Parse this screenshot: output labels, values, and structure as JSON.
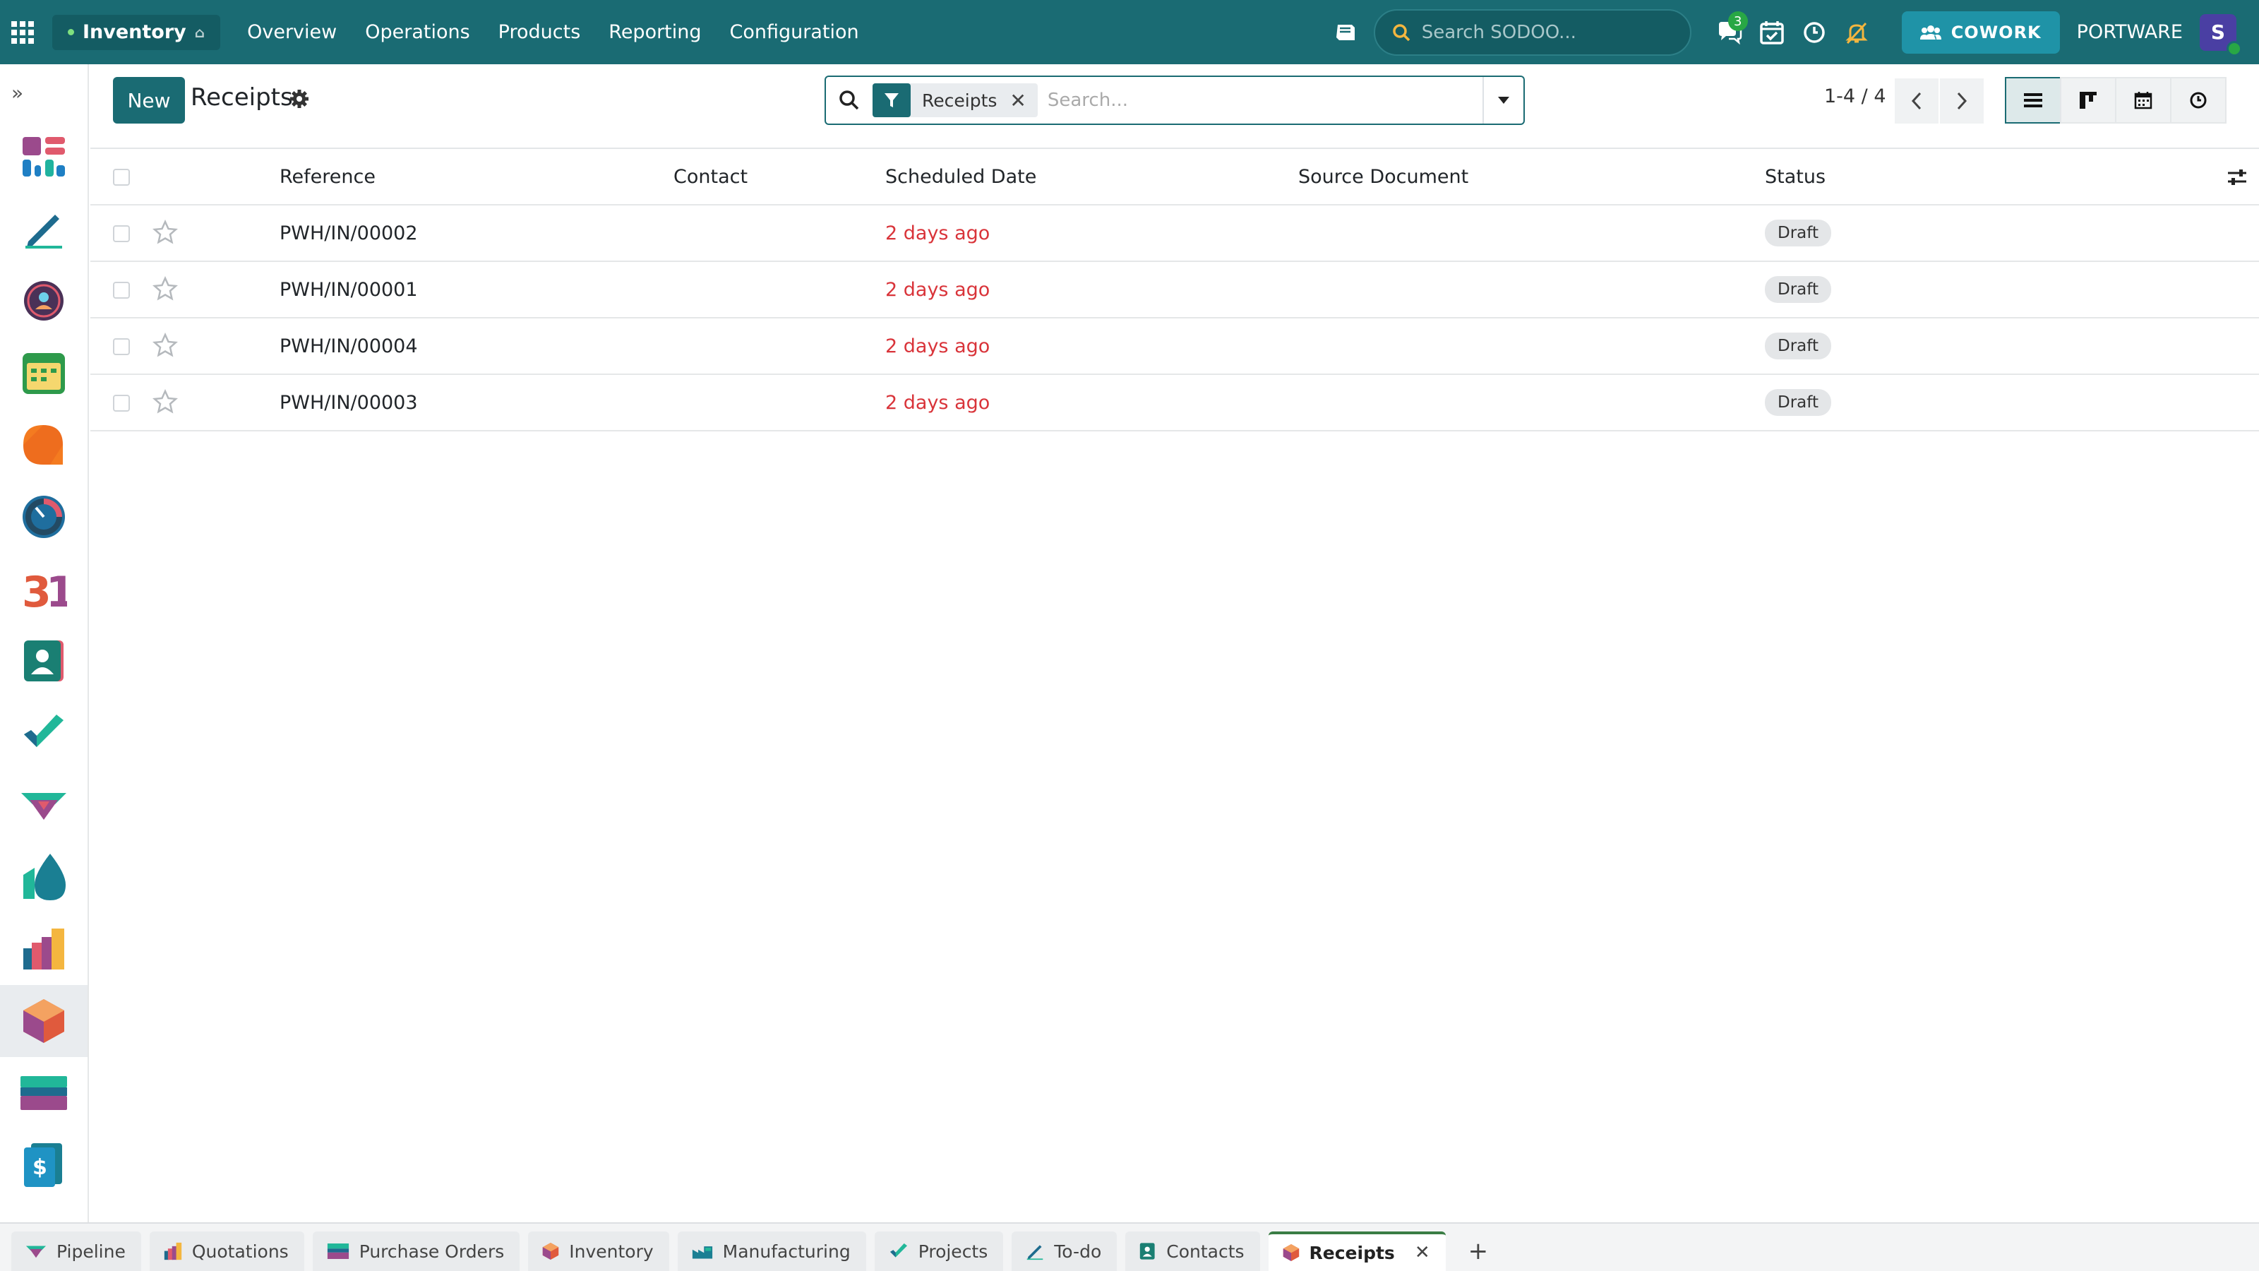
{
  "navbar": {
    "app_name": "Inventory",
    "menu": [
      "Overview",
      "Operations",
      "Products",
      "Reporting",
      "Configuration"
    ],
    "search_placeholder": "Search SODOO...",
    "messages_badge": "3",
    "cowork_label": "COWORK",
    "company": "PORTWARE",
    "avatar_letter": "S",
    "colors": {
      "navbar": "#1a6b73",
      "accent_green": "#28a745"
    }
  },
  "control": {
    "new_label": "New",
    "title": "Receipts",
    "facet_label": "Receipts",
    "search_placeholder": "Search...",
    "pager": "1-4 / 4"
  },
  "list": {
    "columns": [
      "Reference",
      "Contact",
      "Scheduled Date",
      "Source Document",
      "Status"
    ],
    "rows": [
      {
        "reference": "PWH/IN/00002",
        "contact": "",
        "scheduled": "2 days ago",
        "source": "",
        "status": "Draft"
      },
      {
        "reference": "PWH/IN/00001",
        "contact": "",
        "scheduled": "2 days ago",
        "source": "",
        "status": "Draft"
      },
      {
        "reference": "PWH/IN/00004",
        "contact": "",
        "scheduled": "2 days ago",
        "source": "",
        "status": "Draft"
      },
      {
        "reference": "PWH/IN/00003",
        "contact": "",
        "scheduled": "2 days ago",
        "source": "",
        "status": "Draft"
      }
    ]
  },
  "sidebar_apps": [
    "dashboards-icon",
    "todo-icon",
    "community-icon",
    "calendar-icon",
    "discuss-icon",
    "timer-icon",
    "calendar-31-icon",
    "contacts-icon",
    "projects-icon",
    "pipeline-icon",
    "water-icon",
    "manufacturing-icon",
    "inventory-icon",
    "purchase-icon",
    "invoicing-icon"
  ],
  "tabs": [
    {
      "label": "Pipeline",
      "icon": "pipeline-icon"
    },
    {
      "label": "Quotations",
      "icon": "quotations-icon"
    },
    {
      "label": "Purchase Orders",
      "icon": "purchase-icon"
    },
    {
      "label": "Inventory",
      "icon": "inventory-icon"
    },
    {
      "label": "Manufacturing",
      "icon": "manufacturing-icon"
    },
    {
      "label": "Projects",
      "icon": "projects-icon"
    },
    {
      "label": "To-do",
      "icon": "todo-icon"
    },
    {
      "label": "Contacts",
      "icon": "contacts-icon"
    },
    {
      "label": "Receipts",
      "icon": "inventory-icon",
      "active": true
    }
  ]
}
